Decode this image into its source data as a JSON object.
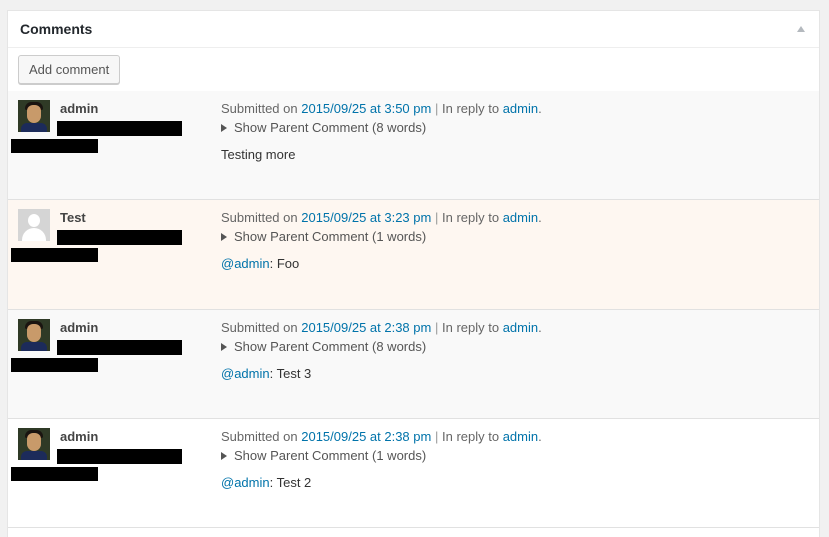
{
  "panel": {
    "title": "Comments",
    "add_button_label": "Add comment"
  },
  "labels": {
    "submitted_on": "Submitted on",
    "separator": "|",
    "in_reply_to": "In reply to",
    "period": "."
  },
  "comments": [
    {
      "author": "admin",
      "avatar": "admin-photo",
      "date": "2015/09/25 at 3:50 pm",
      "reply_to": "admin",
      "show_parent": "Show Parent Comment (8 words)",
      "mention": "",
      "text": "Testing more"
    },
    {
      "author": "Test",
      "avatar": "default-avatar",
      "date": "2015/09/25 at 3:23 pm",
      "reply_to": "admin",
      "show_parent": "Show Parent Comment (1 words)",
      "mention": "@admin",
      "text": ": Foo"
    },
    {
      "author": "admin",
      "avatar": "admin-photo",
      "date": "2015/09/25 at 2:38 pm",
      "reply_to": "admin",
      "show_parent": "Show Parent Comment (8 words)",
      "mention": "@admin",
      "text": ": Test 3"
    },
    {
      "author": "admin",
      "avatar": "admin-photo",
      "date": "2015/09/25 at 2:38 pm",
      "reply_to": "admin",
      "show_parent": "Show Parent Comment (1 words)",
      "mention": "@admin",
      "text": ": Test 2"
    }
  ],
  "colors": {
    "link": "#0073aa",
    "highlight_row": "#fef7f1",
    "alt_row": "#f9f9f9"
  }
}
